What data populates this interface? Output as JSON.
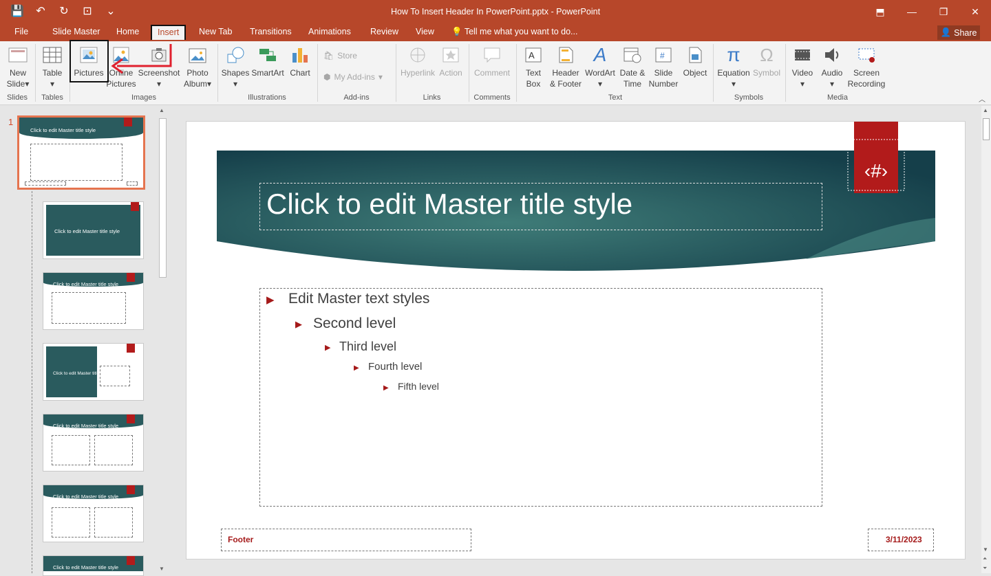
{
  "title_bar": {
    "title": "How To Insert Header In PowerPoint.pptx - PowerPoint"
  },
  "qat": [
    {
      "icon": "save-icon",
      "glyph": "💾"
    },
    {
      "icon": "undo-icon",
      "glyph": "↶"
    },
    {
      "icon": "redo-icon",
      "glyph": "↻"
    },
    {
      "icon": "present-icon",
      "glyph": "⊡"
    },
    {
      "icon": "customize-icon",
      "glyph": "⌄"
    }
  ],
  "tabs": {
    "file": "File",
    "slide_master": "Slide Master",
    "home": "Home",
    "insert": "Insert",
    "new_tab": "New Tab",
    "transitions": "Transitions",
    "animations": "Animations",
    "review": "Review",
    "view": "View",
    "tell_me": "Tell me what you want to do...",
    "share": "Share"
  },
  "ribbon": {
    "new_slide": [
      "New",
      "Slide"
    ],
    "table": "Table",
    "pictures": "Pictures",
    "online_pictures": [
      "Online",
      "Pictures"
    ],
    "screenshot": "Screenshot",
    "photo_album": [
      "Photo",
      "Album"
    ],
    "shapes": "Shapes",
    "smartart": "SmartArt",
    "chart": "Chart",
    "store": "Store",
    "my_addins": "My Add-ins",
    "hyperlink": "Hyperlink",
    "action": "Action",
    "comment": "Comment",
    "text_box": [
      "Text",
      "Box"
    ],
    "header_footer": [
      "Header",
      "& Footer"
    ],
    "wordart": "WordArt",
    "date_time": [
      "Date &",
      "Time"
    ],
    "slide_number": [
      "Slide",
      "Number"
    ],
    "object": "Object",
    "equation": "Equation",
    "symbol": "Symbol",
    "video": "Video",
    "audio": "Audio",
    "screen_recording": [
      "Screen",
      "Recording"
    ],
    "groups": {
      "slides": "Slides",
      "tables": "Tables",
      "images": "Images",
      "illustrations": "Illustrations",
      "addins": "Add-ins",
      "links": "Links",
      "comments": "Comments",
      "text": "Text",
      "symbols": "Symbols",
      "media": "Media"
    }
  },
  "panel": {
    "first_slide_number": "1",
    "thumb_title": "Click to edit Master title style",
    "thumb_title_short": "Click to edit Master title style"
  },
  "slide": {
    "title": "Click to edit Master title style",
    "slide_number": "‹#›",
    "levels": [
      "Edit Master text styles",
      "Second level",
      "Third level",
      "Fourth level",
      "Fifth level"
    ],
    "footer": "Footer",
    "date": "3/11/2023"
  },
  "colors": {
    "accent": "#b7472a",
    "teal": "#2a5b5e",
    "red_ribbon": "#b21b1b",
    "bullet": "#a51a1a"
  }
}
